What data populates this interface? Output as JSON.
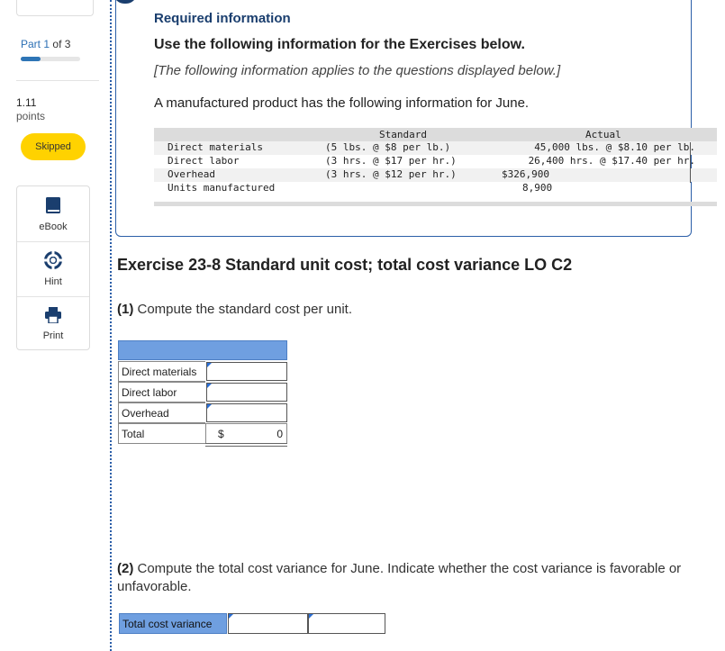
{
  "sidebar": {
    "part_prefix": "Part",
    "part_current": "1",
    "part_of": "of 3",
    "progress_fraction": 0.33,
    "points_value": "1.11",
    "points_label": "points",
    "status_badge": "Skipped",
    "tools": [
      {
        "label": "eBook",
        "icon": "book-icon"
      },
      {
        "label": "Hint",
        "icon": "lifebuoy-icon"
      },
      {
        "label": "Print",
        "icon": "printer-icon"
      }
    ]
  },
  "info": {
    "heading": "Required information",
    "subheading": "Use the following information for the Exercises below.",
    "note": "[The following information applies to the questions displayed below.]",
    "intro": "A manufactured product has the following information for June.",
    "table": {
      "header_standard": "Standard",
      "header_actual": "Actual",
      "rows": [
        {
          "item": "Direct materials",
          "standard": "(5 lbs. @ $8 per lb.)",
          "actual": "45,000 lbs. @ $8.10 per lb."
        },
        {
          "item": "Direct labor",
          "standard": "(3 hrs. @ $17 per hr.)",
          "actual": "26,400 hrs. @ $17.40 per hr."
        },
        {
          "item": "Overhead",
          "standard": "(3 hrs. @ $12 per hr.)",
          "actual": "$326,900"
        },
        {
          "item": "Units manufactured",
          "standard": "",
          "actual": "8,900"
        }
      ]
    }
  },
  "exercise": {
    "title": "Exercise 23-8 Standard unit cost; total cost variance LO C2",
    "q1_num": "(1)",
    "q1_text": " Compute the standard cost per unit.",
    "cost_table": {
      "rows": [
        "Direct materials",
        "Direct labor",
        "Overhead"
      ],
      "total_label": "Total",
      "total_currency": "$",
      "total_value": "0"
    },
    "q2_num": "(2)",
    "q2_text": " Compute the total cost variance for June. Indicate whether the cost variance is favorable or unfavorable.",
    "tcv_label": "Total cost variance"
  },
  "colors": {
    "accent": "#1a3e6e",
    "link_blue": "#2b6fb4",
    "badge_yellow": "#ffd200",
    "table_header_blue": "#6f9fe0"
  }
}
